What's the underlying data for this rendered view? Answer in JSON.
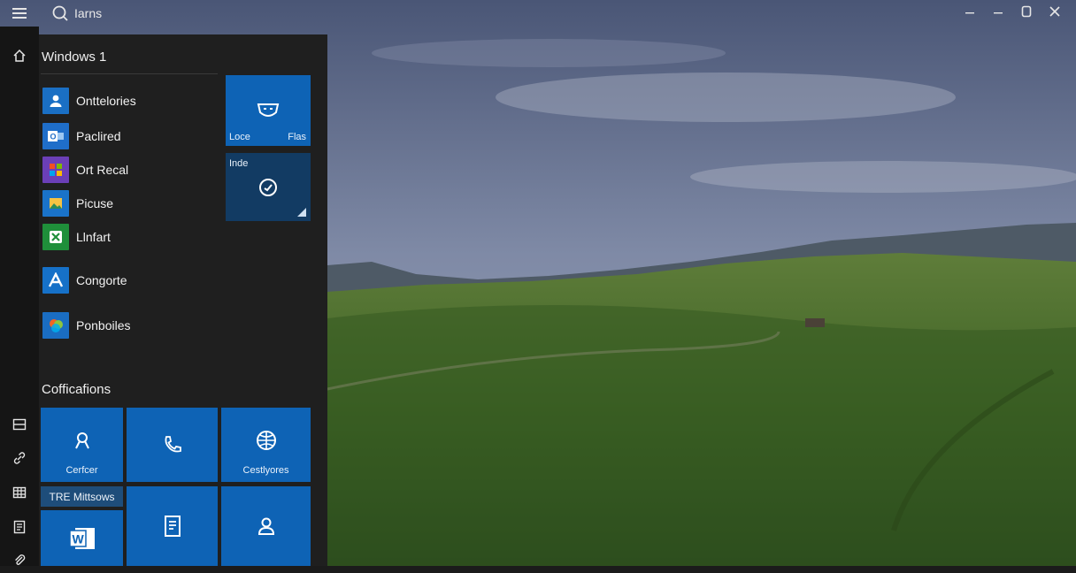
{
  "window": {
    "title": "Iarns",
    "controls": [
      "minimize",
      "restore",
      "maximize",
      "close"
    ]
  },
  "start": {
    "section_top": "Windows 1",
    "apps": [
      {
        "label": "Onttelories",
        "icon": "person-icon",
        "color": "#1a6fc4"
      },
      {
        "label": "Paclired",
        "icon": "outlook-icon",
        "color": "#1f6ec9"
      },
      {
        "label": "Ort Recal",
        "icon": "store-icon",
        "color": "#6b3fb7"
      },
      {
        "label": "Picuse",
        "icon": "photos-icon",
        "color": "#1a73c9"
      },
      {
        "label": "Llnfart",
        "icon": "xbox-icon",
        "color": "#1f8f3a"
      },
      {
        "label": "Congorte",
        "icon": "store-a-icon",
        "color": "#1671c8"
      },
      {
        "label": "Ponboiles",
        "icon": "maps-icon",
        "color": "#1a6dc2"
      }
    ],
    "top_tiles": [
      {
        "left_label": "Loce",
        "right_label": "Flas",
        "icon": "mask-icon"
      },
      {
        "label": "Inde",
        "icon": "sync-icon"
      }
    ],
    "section_bottom": "Cofficafions",
    "bottom_tiles": [
      {
        "label": "Cerfcer",
        "icon": "people-icon"
      },
      {
        "label": "",
        "icon": "phone-icon"
      },
      {
        "label": "Cestlyores",
        "icon": "globe-icon"
      },
      {
        "label": "",
        "icon": "word-icon"
      },
      {
        "label": "",
        "icon": "document-icon"
      },
      {
        "label": "",
        "icon": "contact-icon"
      }
    ],
    "banner": "TRE Mittsows"
  },
  "rail": {
    "items": [
      "home-icon",
      "list-icon",
      "link-icon",
      "grid-icon",
      "book-icon",
      "attach-icon"
    ]
  },
  "colors": {
    "tile_blue": "#0e63b5",
    "tile_dark": "#123b63",
    "panel_bg": "#1f1f1f",
    "rail_bg": "#151515"
  }
}
